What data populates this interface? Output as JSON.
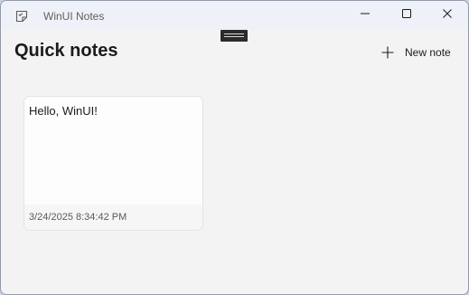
{
  "window": {
    "title": "WinUI Notes",
    "icons": {
      "app": "sticky-note-icon",
      "minimize": "minimize-icon",
      "maximize": "maximize-icon",
      "close": "close-icon"
    }
  },
  "header": {
    "title": "Quick notes",
    "new_note_label": "New note",
    "new_note_icon": "plus-icon"
  },
  "notes": [
    {
      "text": "Hello, WinUI!",
      "date": "3/24/2025 8:34:42 PM"
    }
  ],
  "colors": {
    "title_bar": "#eef1f8",
    "content_background": "#f3f3f3",
    "card_background": "#fdfdfd"
  }
}
